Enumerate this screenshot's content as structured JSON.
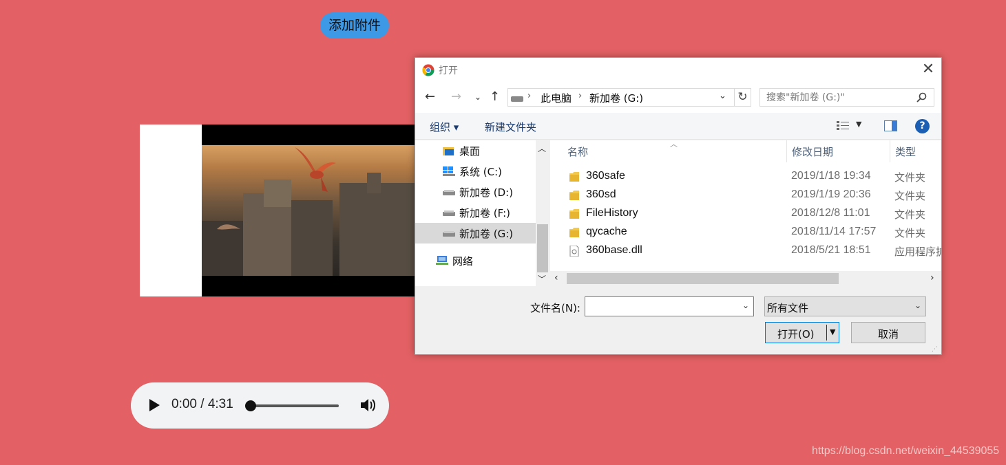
{
  "page": {
    "attach_button": "添加附件",
    "watermark": "https://blog.csdn.net/weixin_44539055"
  },
  "audio": {
    "time": "0:00 / 4:31",
    "progress": 0
  },
  "dialog": {
    "title": "打开",
    "app_icon": "chrome-icon",
    "address": {
      "segments": [
        "此电脑",
        "新加卷 (G:)"
      ]
    },
    "search_placeholder": "搜索\"新加卷 (G:)\"",
    "toolbar": {
      "organize": "组织 ▾",
      "new_folder": "新建文件夹",
      "help": "?"
    },
    "nav_items": [
      {
        "label": "桌面",
        "icon": "desktop-folder-icon",
        "selected": false
      },
      {
        "label": "系统 (C:)",
        "icon": "windows-drive-icon",
        "selected": false
      },
      {
        "label": "新加卷 (D:)",
        "icon": "drive-icon",
        "selected": false
      },
      {
        "label": "新加卷 (F:)",
        "icon": "drive-icon",
        "selected": false
      },
      {
        "label": "新加卷 (G:)",
        "icon": "drive-icon",
        "selected": true
      },
      {
        "label": "网络",
        "icon": "network-icon",
        "selected": false
      }
    ],
    "columns": {
      "name": "名称",
      "modified": "修改日期",
      "type": "类型"
    },
    "files": [
      {
        "name": "360safe",
        "modified": "2019/1/18 19:34",
        "type": "文件夹",
        "icon": "folder-icon"
      },
      {
        "name": "360sd",
        "modified": "2019/1/19 20:36",
        "type": "文件夹",
        "icon": "folder-icon"
      },
      {
        "name": "FileHistory",
        "modified": "2018/12/8 11:01",
        "type": "文件夹",
        "icon": "folder-icon"
      },
      {
        "name": "qycache",
        "modified": "2018/11/14 17:57",
        "type": "文件夹",
        "icon": "folder-icon"
      },
      {
        "name": "360base.dll",
        "modified": "2018/5/21 18:51",
        "type": "应用程序扩",
        "icon": "dll-file-icon"
      }
    ],
    "filename_label": "文件名(N):",
    "filename_value": "",
    "filetype_value": "所有文件",
    "open_button": "打开(O)",
    "cancel_button": "取消"
  },
  "colors": {
    "background": "#e36164",
    "accent_button": "#3d98e6",
    "dialog_focus": "#0078d7"
  }
}
